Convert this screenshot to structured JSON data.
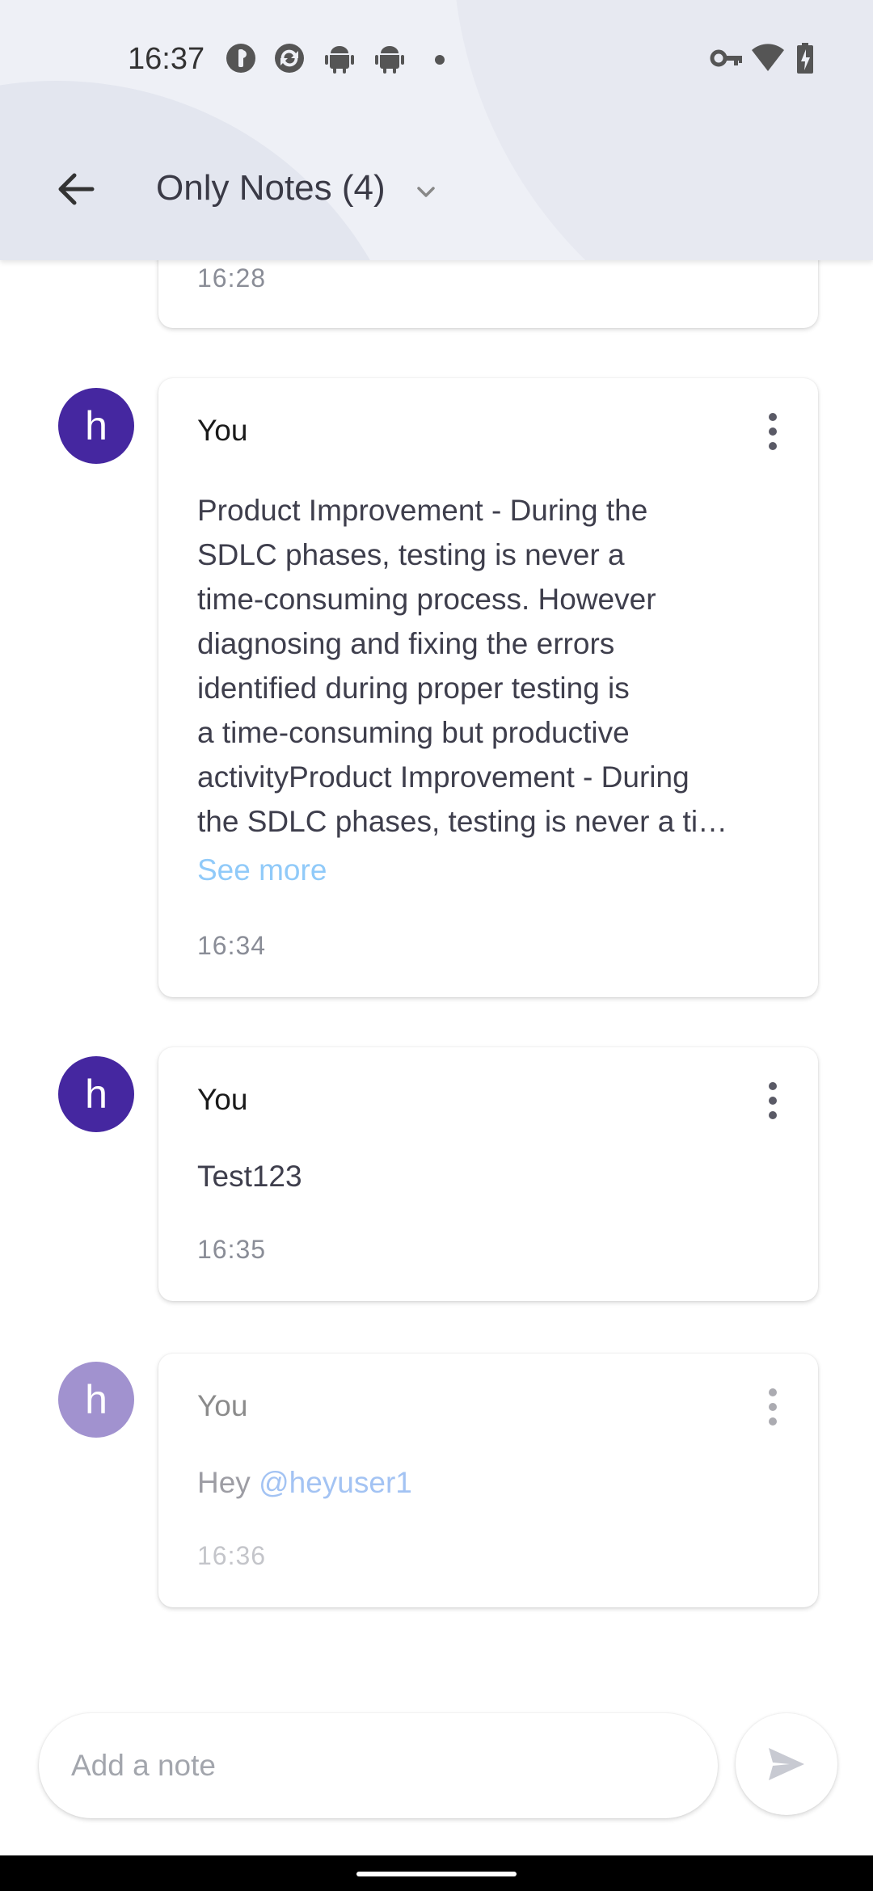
{
  "status_bar": {
    "time": "16:37",
    "left_icons": [
      "notification-app-icon",
      "sync-app-icon",
      "android-icon",
      "android-icon",
      "more-dot"
    ],
    "right_icons": [
      "vpn-key-icon",
      "wifi-icon",
      "battery-charging-icon"
    ]
  },
  "header": {
    "back_icon": "arrow-left-icon",
    "title": "Only Notes (4)",
    "dropdown_icon": "chevron-down-icon"
  },
  "notes": [
    {
      "timestamp": "16:28"
    },
    {
      "avatar_letter": "h",
      "author": "You",
      "text": "Product Improvement - During the\nSDLC phases, testing is never a\ntime-consuming process. However\ndiagnosing and fixing the errors\nidentified during proper testing is\na time-consuming but productive\nactivityProduct Improvement - During\nthe SDLC phases, testing is never a ti…",
      "see_more": "See more",
      "timestamp": "16:34"
    },
    {
      "avatar_letter": "h",
      "author": "You",
      "text": "Test123",
      "timestamp": "16:35"
    },
    {
      "avatar_letter": "h",
      "author": "You",
      "text_prefix": "Hey ",
      "mention": "@heyuser1",
      "timestamp": "16:36"
    }
  ],
  "composer": {
    "placeholder": "Add a note",
    "send_icon": "send-icon"
  },
  "colors": {
    "avatar": "#4527a0",
    "see_more": "#90caf9",
    "mention": "#4a89e8",
    "header_bg": "#eef0f6"
  }
}
